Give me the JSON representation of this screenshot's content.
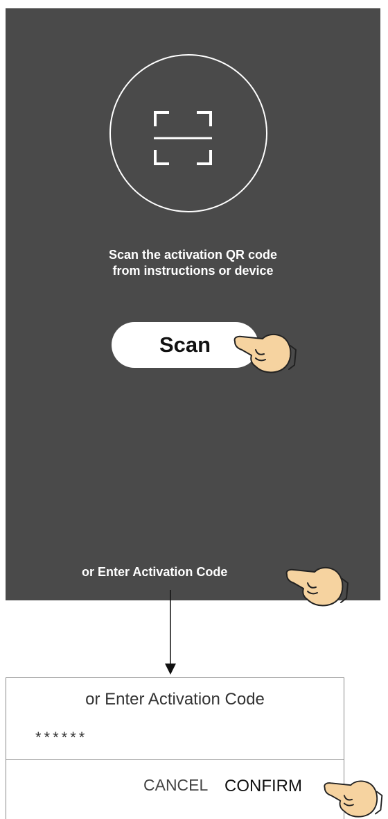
{
  "scan_screen": {
    "instruction_line1": "Scan the activation QR code",
    "instruction_line2": "from instructions or device",
    "scan_button_label": "Scan",
    "enter_code_link": "or Enter Activation Code"
  },
  "dialog": {
    "title": "or Enter Activation Code",
    "code_value": "******",
    "cancel_label": "CANCEL",
    "confirm_label": "CONFIRM"
  },
  "icons": {
    "qr": "qr-scan-frame-icon",
    "hand": "pointing-hand-icon",
    "arrow": "arrow-down-icon"
  },
  "colors": {
    "screen_background": "#4a4a4a",
    "hand_fill": "#f6d3a0"
  }
}
